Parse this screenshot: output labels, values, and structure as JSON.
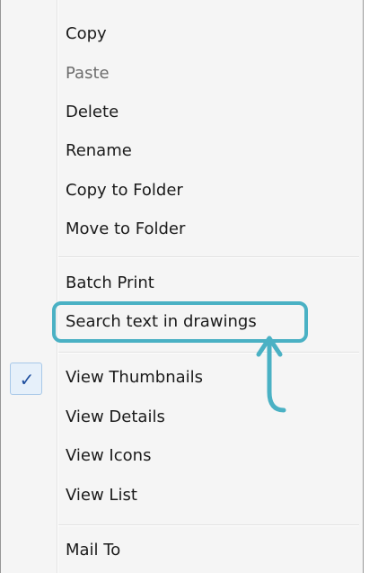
{
  "menu": {
    "items": [
      {
        "label": "Copy",
        "enabled": true
      },
      {
        "label": "Paste",
        "enabled": false
      },
      {
        "label": "Delete",
        "enabled": true
      },
      {
        "label": "Rename",
        "enabled": true
      },
      {
        "label": "Copy to Folder",
        "enabled": true
      },
      {
        "label": "Move to Folder",
        "enabled": true
      },
      {
        "label": "Batch Print",
        "enabled": true
      },
      {
        "label": "Search text in drawings",
        "enabled": true,
        "highlighted": true
      },
      {
        "label": "View Thumbnails",
        "enabled": true,
        "checked": true
      },
      {
        "label": "View Details",
        "enabled": true
      },
      {
        "label": "View Icons",
        "enabled": true
      },
      {
        "label": "View List",
        "enabled": true
      },
      {
        "label": "Mail To",
        "enabled": true
      }
    ],
    "check_glyph": "✓"
  },
  "annotation": {
    "highlight_color": "#4ab1c4",
    "arrow_icon": "curved-up-arrow"
  }
}
